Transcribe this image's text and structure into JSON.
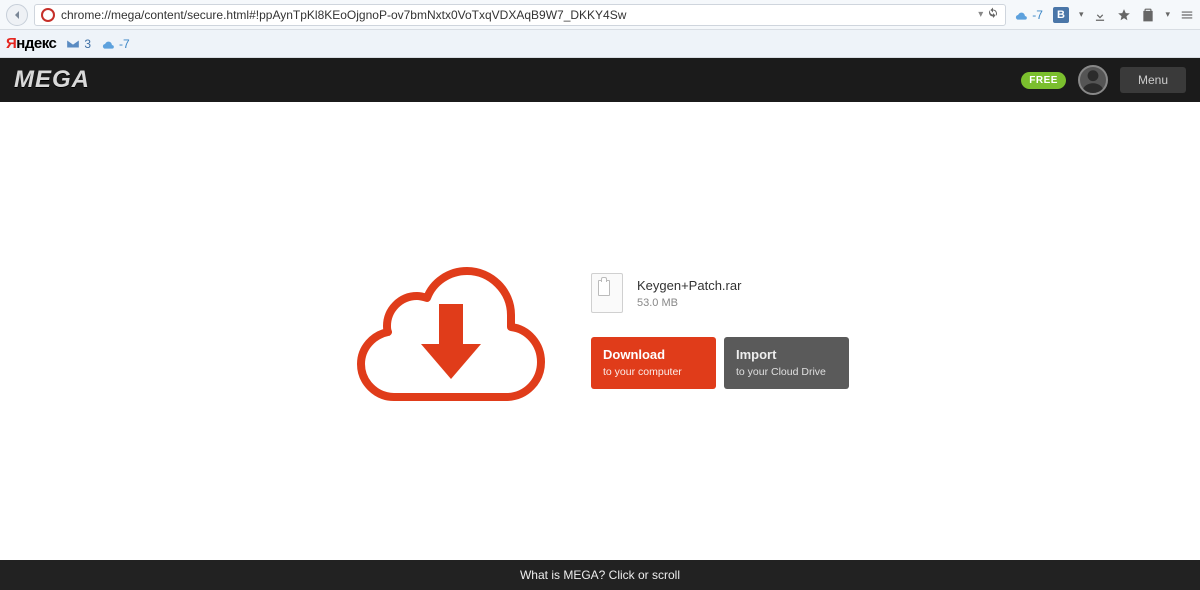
{
  "browser": {
    "url": "chrome://mega/content/secure.html#!ppAynTpKl8KEoOjgnoP-ov7bmNxtx0VoTxqVDXAqB9W7_DKKY4Sw",
    "weather_temp": "-7",
    "vk_label": "B"
  },
  "toolbar2": {
    "yandex_y": "Я",
    "yandex_rest": "ндекс",
    "mail_count": "3",
    "weather_temp": "-7"
  },
  "mega": {
    "logo": "MEGA",
    "free_badge": "FREE",
    "menu_label": "Menu"
  },
  "file": {
    "name": "Keygen+Patch.rar",
    "size": "53.0 MB"
  },
  "buttons": {
    "download_title": "Download",
    "download_sub": "to your computer",
    "import_title": "Import",
    "import_sub": "to your Cloud Drive"
  },
  "footer": {
    "text": "What is MEGA? Click or scroll"
  },
  "colors": {
    "accent": "#e03c1a",
    "header": "#1b1b1b",
    "free": "#7bbf2e"
  }
}
